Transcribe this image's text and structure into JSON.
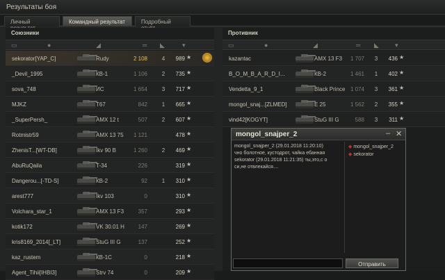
{
  "window": {
    "title": "Результаты боя"
  },
  "tabs": [
    "Личный результат",
    "Командный результат",
    "Подробный отчёт"
  ],
  "allies": {
    "title": "Союзники",
    "rows": [
      {
        "name": "sekorator[YAP_C]",
        "tank": "Rudy",
        "dmg": "2 108",
        "kills": "4",
        "xp": "989",
        "me": true
      },
      {
        "name": "_Devil_1995",
        "tank": "КВ-1",
        "dmg": "1 106",
        "kills": "2",
        "xp": "735"
      },
      {
        "name": "sova_748",
        "tank": "ИС",
        "dmg": "1 654",
        "kills": "3",
        "xp": "717"
      },
      {
        "name": "MJKZ",
        "tank": "T67",
        "dmg": "842",
        "kills": "1",
        "xp": "665"
      },
      {
        "name": "_SuperPersh_",
        "tank": "AMX 12 t",
        "dmg": "507",
        "kills": "2",
        "xp": "607"
      },
      {
        "name": "Rotmistr59",
        "tank": "AMX 13 75",
        "dmg": "1 121",
        "kills": "",
        "xp": "478"
      },
      {
        "name": "ZhenisT...[WT-DB]",
        "tank": "Ikv 90 B",
        "dmg": "1 260",
        "kills": "2",
        "xp": "469"
      },
      {
        "name": "AbuRuQaila",
        "tank": "T-34",
        "dmg": "226",
        "kills": "",
        "xp": "319"
      },
      {
        "name": "Dangerou...[-TD-S]",
        "tank": "КВ-2",
        "dmg": "92",
        "kills": "1",
        "xp": "310"
      },
      {
        "name": "arest777",
        "tank": "Ikv 103",
        "dmg": "0",
        "kills": "",
        "xp": "310"
      },
      {
        "name": "Volchara_star_1",
        "tank": "AMX 13 F3",
        "dmg": "357",
        "kills": "",
        "xp": "293"
      },
      {
        "name": "kotik172",
        "tank": "VK 30.01 H",
        "dmg": "147",
        "kills": "",
        "xp": "269"
      },
      {
        "name": "kris8169_2014[_LT]",
        "tank": "StuG III G",
        "dmg": "137",
        "kills": "",
        "xp": "252"
      },
      {
        "name": "kaz_rustem",
        "tank": "КВ-1С",
        "dmg": "0",
        "kills": "",
        "xp": "218"
      },
      {
        "name": "Agent_Tihii[IHBI3]",
        "tank": "Strv 74",
        "dmg": "0",
        "kills": "",
        "xp": "209"
      }
    ]
  },
  "enemies": {
    "title": "Противник",
    "rows": [
      {
        "name": "kazantac",
        "tank": "AMX 13 F3",
        "dmg": "1 707",
        "kills": "3",
        "xp": "436"
      },
      {
        "name": "B_O_M_B_A_R_D_I...",
        "tank": "КВ-2",
        "dmg": "1 461",
        "kills": "1",
        "xp": "402"
      },
      {
        "name": "Vendetta_9_1",
        "tank": "Black Prince",
        "dmg": "1 074",
        "kills": "3",
        "xp": "361"
      },
      {
        "name": "mongol_snaj...[ZLMED]",
        "tank": "E 25",
        "dmg": "1 562",
        "kills": "2",
        "xp": "355"
      },
      {
        "name": "vind42[KOGYT]",
        "tank": "StuG III G",
        "dmg": "588",
        "kills": "3",
        "xp": "311"
      }
    ]
  },
  "chat": {
    "title": "mongol_snajper_2",
    "messages": [
      "mongol_snajper_2 (29.01.2018 11:20:10)",
      "чно болотное, кустодрот, чайка ебанная",
      "sekorator (29.01.2018 11:21:35) ты,это,с о",
      "си,не отвлекайся...."
    ],
    "users": [
      "mongol_snajper_2",
      "sekorator"
    ],
    "send_label": "Отправить",
    "input_value": ""
  }
}
